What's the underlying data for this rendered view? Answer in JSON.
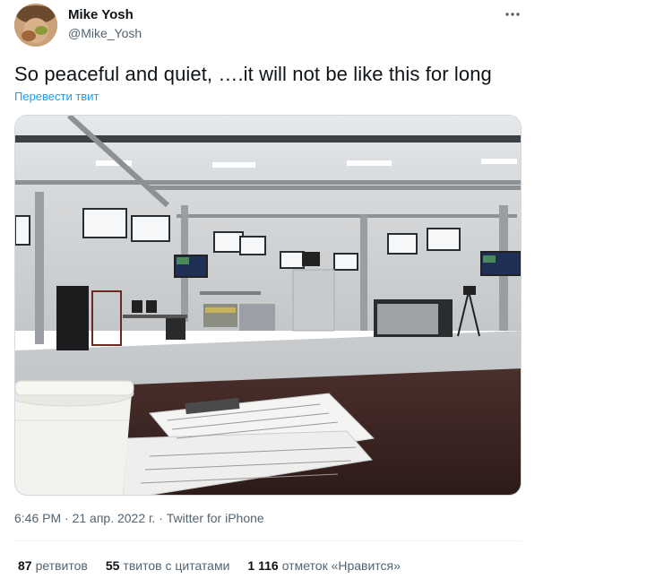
{
  "author": {
    "name": "Mike Yosh",
    "handle": "@Mike_Yosh"
  },
  "tweet": {
    "text": "So peaceful and quiet, ….it will not be like this for long",
    "translate_label": "Перевести твит"
  },
  "meta": {
    "time": "6:46 PM",
    "separator": " · ",
    "date": "21 апр. 2022 г.",
    "source": "Twitter for iPhone"
  },
  "stats": {
    "retweets_count": "87",
    "retweets_label": "ретвитов",
    "quotes_count": "55",
    "quotes_label": "твитов с цитатами",
    "likes_count": "1 116",
    "likes_label": "отметок «Нравится»"
  },
  "icons": {
    "more": "more-horizontal-icon"
  }
}
